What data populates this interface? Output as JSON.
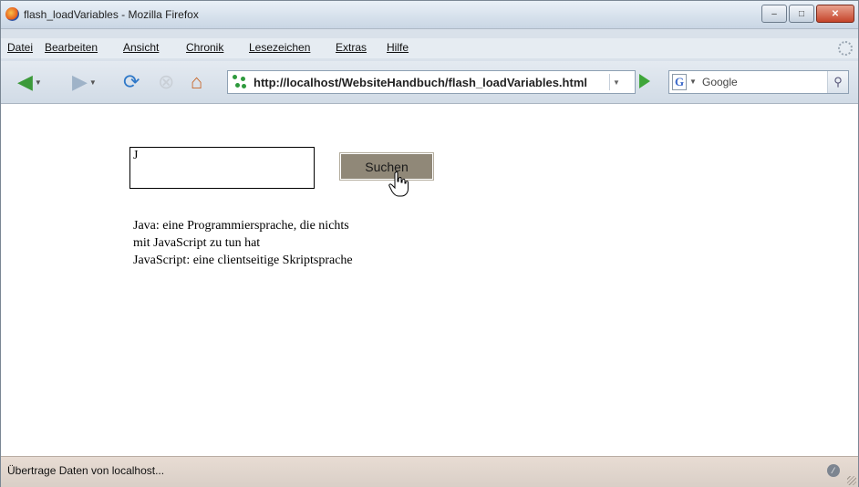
{
  "window": {
    "title": "flash_loadVariables - Mozilla Firefox",
    "controls": {
      "minimize": "–",
      "maximize": "□",
      "close": "✕"
    }
  },
  "menubar": {
    "items": [
      "Datei",
      "Bearbeiten",
      "Ansicht",
      "Chronik",
      "Lesezeichen",
      "Extras",
      "Hilfe"
    ]
  },
  "navbar": {
    "url": "http://localhost/WebsiteHandbuch/flash_loadVariables.html",
    "search_placeholder": "Google",
    "icons": [
      "back-arrow-icon",
      "forward-arrow-icon",
      "reload-icon",
      "stop-icon",
      "home-icon",
      "go-icon",
      "google-icon",
      "search-icon"
    ],
    "colors": {
      "back": "#3c9a3a",
      "reload": "#2f78c8",
      "stop": "#c9cfd6",
      "home": "#c8672a"
    }
  },
  "page": {
    "query_value": "J",
    "search_button": "Suchen",
    "results": [
      "Java: eine Programmiersprache, die nichts",
      "mit JavaScript zu tun hat",
      "JavaScript: eine clientseitige Skriptsprache"
    ],
    "button_color": "#908878"
  },
  "statusbar": {
    "text": "Übertrage Daten von localhost..."
  }
}
